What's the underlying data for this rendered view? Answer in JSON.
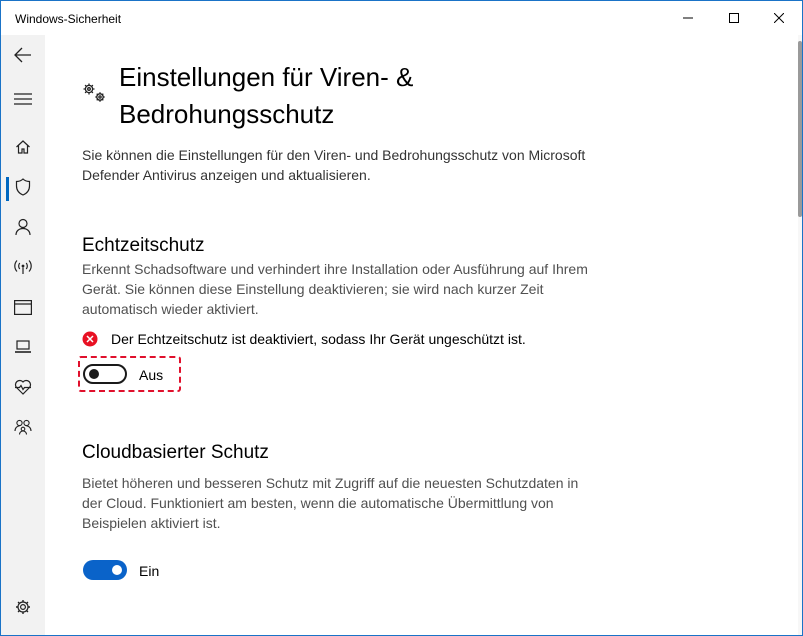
{
  "window": {
    "title": "Windows-Sicherheit"
  },
  "page": {
    "title": "Einstellungen für Viren- & Bedrohungsschutz",
    "title_line1": "Einstellungen für Viren- &",
    "title_line2": "Bedrohungsschutz",
    "intro": "Sie können die Einstellungen für den Viren- und Bedrohungsschutz von Microsoft Defender Antivirus anzeigen und aktualisieren."
  },
  "realtime": {
    "title": "Echtzeitschutz",
    "description": "Erkennt Schadsoftware und verhindert ihre Installation oder Ausführung auf Ihrem Gerät. Sie können diese Einstellung deaktivieren; sie wird nach kurzer Zeit automatisch wieder aktiviert.",
    "warning": "Der Echtzeitschutz ist deaktiviert, sodass Ihr Gerät ungeschützt ist.",
    "toggle_state": "off",
    "toggle_label": "Aus"
  },
  "cloud": {
    "title": "Cloudbasierter Schutz",
    "description": "Bietet höheren und besseren Schutz mit Zugriff auf die neuesten Schutzdaten in der Cloud. Funktioniert am besten, wenn die automatische Übermittlung von Beispielen aktiviert ist.",
    "toggle_state": "on",
    "toggle_label": "Ein"
  },
  "sidebar": {
    "items": [
      {
        "icon": "back-arrow-icon"
      },
      {
        "icon": "hamburger-menu-icon"
      },
      {
        "icon": "home-icon"
      },
      {
        "icon": "shield-icon",
        "active": true
      },
      {
        "icon": "person-icon"
      },
      {
        "icon": "wireless-antenna-icon"
      },
      {
        "icon": "app-browser-window-icon"
      },
      {
        "icon": "laptop-icon"
      },
      {
        "icon": "heart-pulse-icon"
      },
      {
        "icon": "family-icon"
      },
      {
        "icon": "gear-icon"
      }
    ]
  },
  "colors": {
    "accent": "#0067c0",
    "toggle_on": "#0a63c9",
    "error_red": "#e81123",
    "highlight_red": "#e0102c",
    "window_border": "#1a73c7"
  }
}
